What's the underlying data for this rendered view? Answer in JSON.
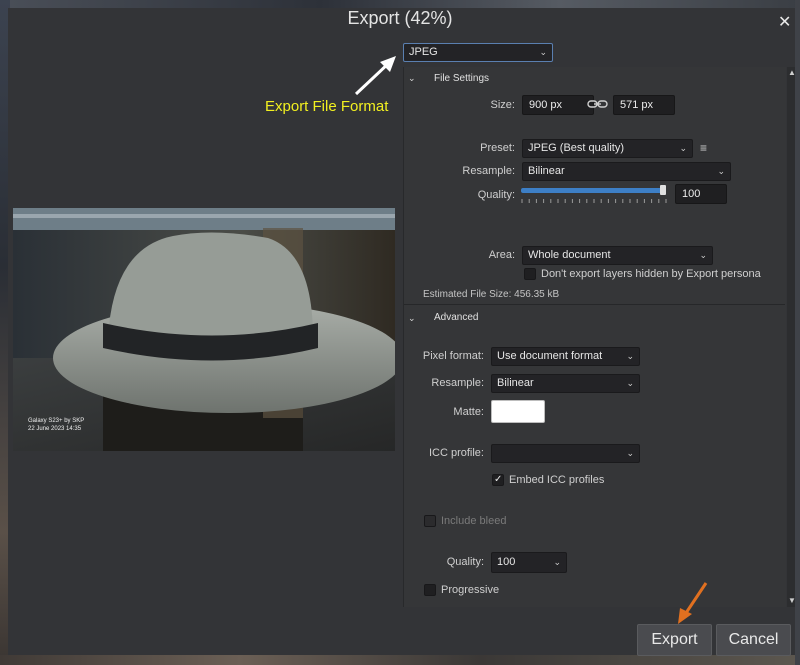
{
  "dialog": {
    "title": "Export (42%)",
    "close_glyph": "✕",
    "format": "JPEG"
  },
  "annotation": {
    "text": "Export File Format",
    "color": "#f2f020"
  },
  "file_settings": {
    "heading": "File Settings",
    "size_label": "Size:",
    "width": "900 px",
    "height": "571 px",
    "preset_label": "Preset:",
    "preset": "JPEG (Best quality)",
    "resample_label": "Resample:",
    "resample": "Bilinear",
    "quality_label": "Quality:",
    "quality": "100",
    "quality_fraction": 1.0,
    "area_label": "Area:",
    "area": "Whole document",
    "hidden_layers_label": "Don't export layers hidden by Export persona",
    "estimated_size": "Estimated File Size: 456.35 kB"
  },
  "advanced": {
    "heading": "Advanced",
    "pixel_format_label": "Pixel format:",
    "pixel_format": "Use document format",
    "resample_label": "Resample:",
    "resample": "Bilinear",
    "matte_label": "Matte:",
    "matte_color": "#ffffff",
    "icc_label": "ICC profile:",
    "icc_value": "",
    "embed_icc_label": "Embed ICC profiles",
    "bleed_label": "Include bleed",
    "quality_label": "Quality:",
    "quality": "100",
    "progressive_label": "Progressive"
  },
  "preview": {
    "watermark_line1": "Galaxy S23+ by SKP",
    "watermark_line2": "22 June 2023 14:35"
  },
  "buttons": {
    "export": "Export",
    "cancel": "Cancel"
  },
  "colors": {
    "accent_arrow": "#e07020",
    "annotation": "#f2f020"
  }
}
